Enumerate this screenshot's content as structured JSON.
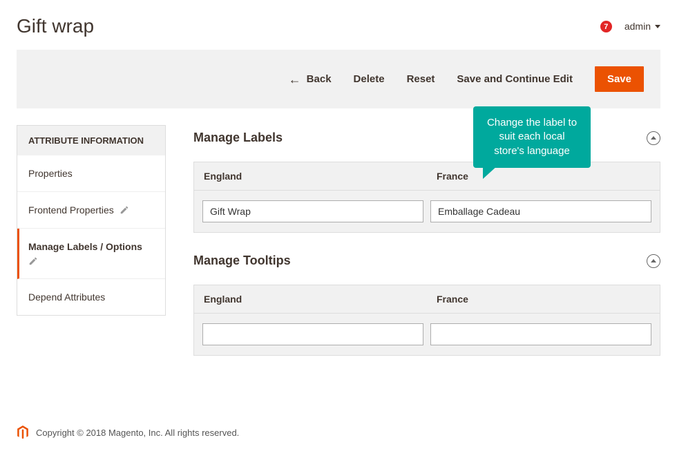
{
  "header": {
    "title": "Gift wrap",
    "notification_count": "7",
    "user_label": "admin"
  },
  "actions": {
    "back": "Back",
    "delete": "Delete",
    "reset": "Reset",
    "save_continue": "Save and Continue Edit",
    "save": "Save"
  },
  "sidebar": {
    "header": "ATTRIBUTE INFORMATION",
    "items": [
      {
        "label": "Properties",
        "active": false,
        "has_pencil": false
      },
      {
        "label": "Frontend Properties",
        "active": false,
        "has_pencil": true
      },
      {
        "label": "Manage Labels / Options",
        "active": true,
        "has_pencil": true
      },
      {
        "label": "Depend Attributes",
        "active": false,
        "has_pencil": false
      }
    ]
  },
  "sections": {
    "labels": {
      "title": "Manage Labels",
      "columns": [
        "England",
        "France"
      ],
      "values": [
        "Gift Wrap",
        "Emballage Cadeau"
      ]
    },
    "tooltips": {
      "title": "Manage Tooltips",
      "columns": [
        "England",
        "France"
      ],
      "values": [
        "",
        ""
      ]
    }
  },
  "callout": "Change the label to suit each local store's language",
  "footer": {
    "copyright": "Copyright © 2018 Magento, Inc. All rights reserved."
  }
}
